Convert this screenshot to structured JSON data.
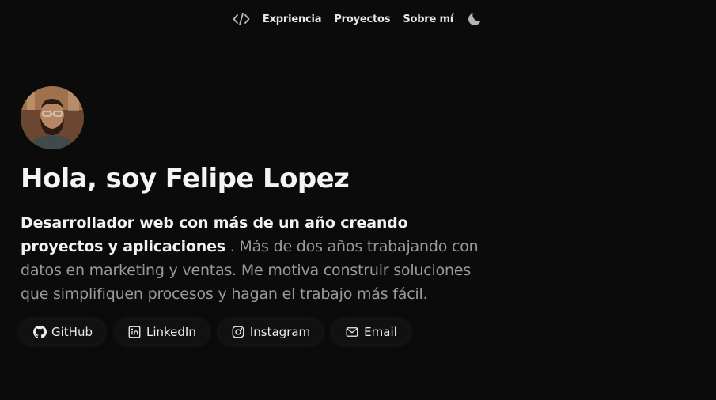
{
  "nav": {
    "icon": "code-icon",
    "items": [
      {
        "label": "Exprienc­ia"
      },
      {
        "label": "Proyectos"
      },
      {
        "label": "Sobre mí"
      }
    ],
    "theme_icon": "moon-icon"
  },
  "hero": {
    "avatar_alt": "avatar",
    "title": "Hola, soy Felipe Lopez",
    "bio_strong": "Desarrollador web con más de un año creando proyectos y aplicaciones",
    "bio_rest": " . Más de dos años trabajando con datos en marketing y ventas. Me motiva construir soluciones que simplifiquen procesos y hagan el trabajo más fácil."
  },
  "socials": [
    {
      "label": "GitHub",
      "icon": "github-icon"
    },
    {
      "label": "LinkedIn",
      "icon": "linkedin-icon"
    },
    {
      "label": "Instagram",
      "icon": "instagram-icon"
    },
    {
      "label": "Email",
      "icon": "mail-icon"
    }
  ],
  "colors": {
    "background": "#0b0b0c",
    "text": "#f2f2f2",
    "muted": "#9a9a9a"
  }
}
